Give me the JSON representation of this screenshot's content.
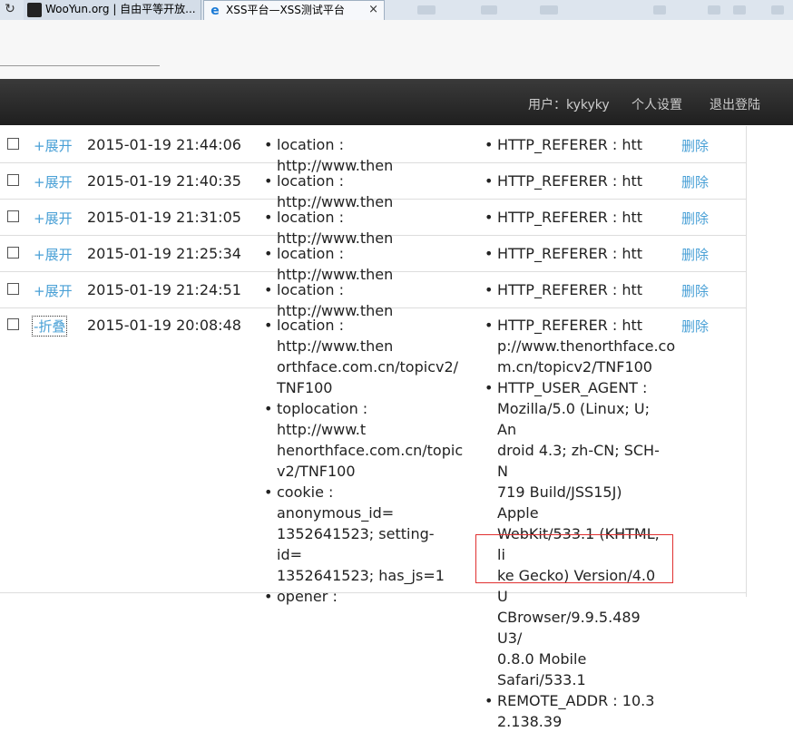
{
  "browser": {
    "tabs": [
      {
        "title": "WooYun.org | 自由平等开放..."
      },
      {
        "title": "XSS平台—XSS测试平台",
        "close": "×"
      }
    ]
  },
  "nav": {
    "user_label": "用户：kykyky",
    "settings_label": "个人设置",
    "logout_label": "退出登陆"
  },
  "rows": [
    {
      "toggle": "+展开",
      "time": "2015-01-19 21:44:06",
      "col1": [
        "location : http://www.then"
      ],
      "col2": [
        "HTTP_REFERER : htt"
      ],
      "delete": "删除"
    },
    {
      "toggle": "+展开",
      "time": "2015-01-19 21:40:35",
      "col1": [
        "location : http://www.then"
      ],
      "col2": [
        "HTTP_REFERER : htt"
      ],
      "delete": "删除"
    },
    {
      "toggle": "+展开",
      "time": "2015-01-19 21:31:05",
      "col1": [
        "location : http://www.then"
      ],
      "col2": [
        "HTTP_REFERER : htt"
      ],
      "delete": "删除"
    },
    {
      "toggle": "+展开",
      "time": "2015-01-19 21:25:34",
      "col1": [
        "location : http://www.then"
      ],
      "col2": [
        "HTTP_REFERER : htt"
      ],
      "delete": "删除"
    },
    {
      "toggle": "+展开",
      "time": "2015-01-19 21:24:51",
      "col1": [
        "location : http://www.then"
      ],
      "col2": [
        "HTTP_REFERER : htt"
      ],
      "delete": "删除"
    },
    {
      "toggle": "-折叠",
      "time": "2015-01-19 20:08:48",
      "col1": [
        [
          "location : http://www.then",
          "orthface.com.cn/topicv2/",
          "TNF100"
        ],
        [
          "toplocation : http://www.t",
          "henorthface.com.cn/topic",
          "v2/TNF100"
        ],
        [
          "cookie : anonymous_id=",
          "1352641523; setting-id=",
          "1352641523; has_js=1"
        ],
        [
          "opener :"
        ]
      ],
      "col2": [
        [
          "HTTP_REFERER : htt",
          "p://www.thenorthface.co",
          "m.cn/topicv2/TNF100"
        ],
        [
          "HTTP_USER_AGENT :",
          "Mozilla/5.0 (Linux; U; An",
          "droid 4.3; zh-CN; SCH-N",
          "719 Build/JSS15J) Apple",
          "WebKit/533.1 (KHTML, li",
          "ke Gecko) Version/4.0 U",
          "CBrowser/9.9.5.489 U3/",
          "0.8.0 Mobile Safari/533.1"
        ],
        [
          "REMOTE_ADDR : 10.3",
          "2.138.39"
        ]
      ],
      "delete": "删除"
    }
  ]
}
